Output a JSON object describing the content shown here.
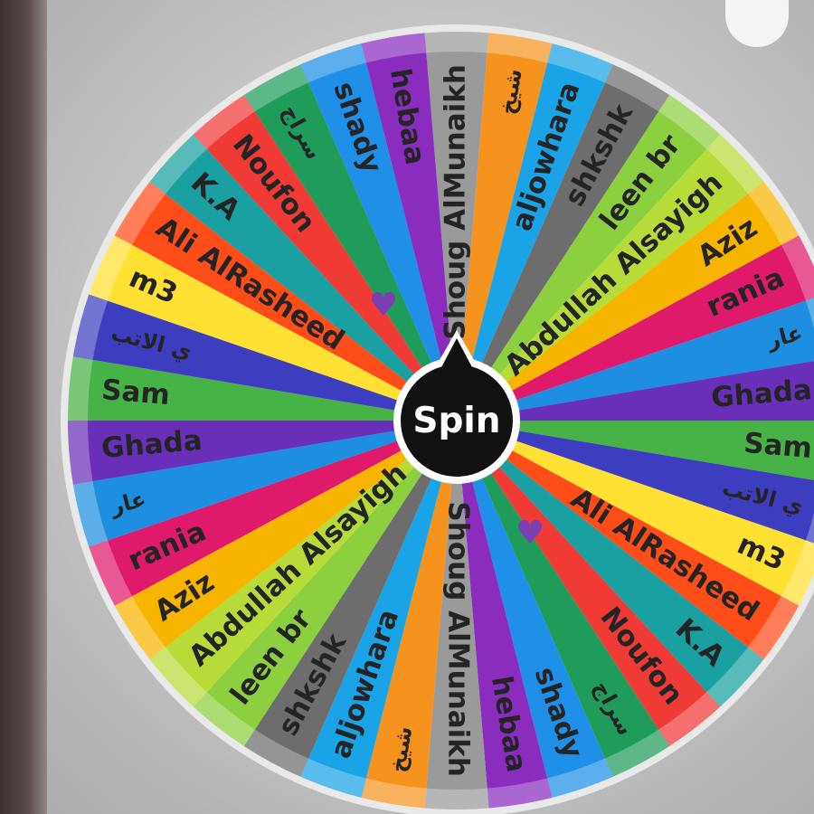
{
  "app": {
    "spin_label": "Spin",
    "entries": [
      "Shoug AlMunaikh",
      "شيخ",
      "aljowhara",
      "shkshk",
      "leen br",
      "Abdullah Alsayigh",
      "Aziz",
      "rania",
      "عار",
      "Ghada",
      "Sam",
      "ي الاتب",
      "m3",
      "Ali AlRasheed",
      "K.A",
      "Noufon",
      "سراج",
      "shady",
      "hebaa",
      "Shoug AlMunaikh",
      "شيخ",
      "aljowhara",
      "shkshk",
      "leen br",
      "Abdullah Alsayigh",
      "Aziz",
      "rania",
      "عار",
      "Ghada",
      "Sam",
      "ي الاتب",
      "m3",
      "Ali AlRasheed",
      "K.A",
      "Noufon",
      "سراج",
      "shady",
      "hebaa"
    ],
    "heart_icon": "heart-icon"
  },
  "colors": {
    "segments": [
      "#9a9a9a",
      "#f6931f",
      "#1aa3e6",
      "#6d6d6d",
      "#8ccf3f",
      "#b7dc3a",
      "#f7b500",
      "#e01a6b",
      "#1e8fe0",
      "#6a2fb8",
      "#47b246",
      "#3d3dbf",
      "#ffe033",
      "#ff4d1a",
      "#1aa0a0",
      "#ef3a36",
      "#1f9c5a",
      "#1f8fe8",
      "#8a2dbf"
    ],
    "spin_button": "#111111",
    "heart": "#7a3fb0"
  }
}
